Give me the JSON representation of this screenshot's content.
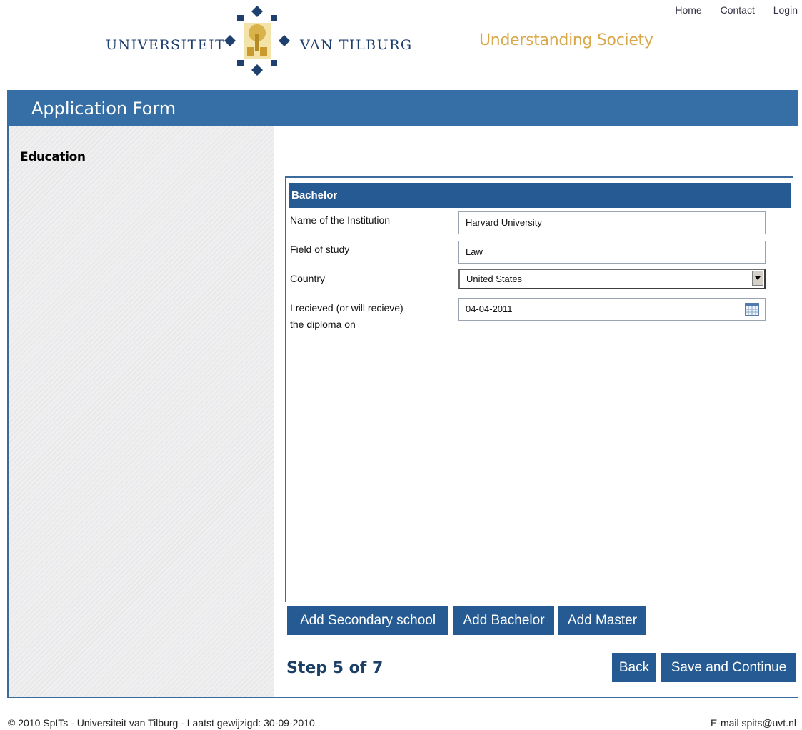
{
  "header": {
    "logo_left": "UNIVERSITEIT",
    "logo_right": "VAN TILBURG",
    "tagline": "Understanding Society",
    "nav": [
      "Home",
      "Contact",
      "Login"
    ]
  },
  "page_title": "Application Form",
  "sidebar": {
    "section_title": "Education"
  },
  "panel": {
    "heading": "Bachelor",
    "fields": {
      "institution": {
        "label": "Name of the Institution",
        "value": "Harvard University"
      },
      "field_of_study": {
        "label": "Field of study",
        "value": "Law"
      },
      "country": {
        "label": "Country",
        "value": "United States"
      },
      "diploma_date": {
        "label_line1": "I recieved (or will recieve)",
        "label_line2": "the diploma on",
        "value": "04-04-2011"
      }
    }
  },
  "buttons": {
    "add_secondary": "Add Secondary school",
    "add_bachelor": "Add Bachelor",
    "add_master": "Add Master",
    "back": "Back",
    "save_continue": "Save and Continue"
  },
  "step": "Step 5 of 7",
  "footer": {
    "copyright": "© 2010 SpITs - Universiteit van Tilburg - Laatst gewijzigd: 30-09-2010",
    "email": "E-mail spits@uvt.nl"
  },
  "colors": {
    "brand_blue": "#255b92",
    "title_blue": "#356fa6",
    "tagline_gold": "#d9a84b"
  }
}
